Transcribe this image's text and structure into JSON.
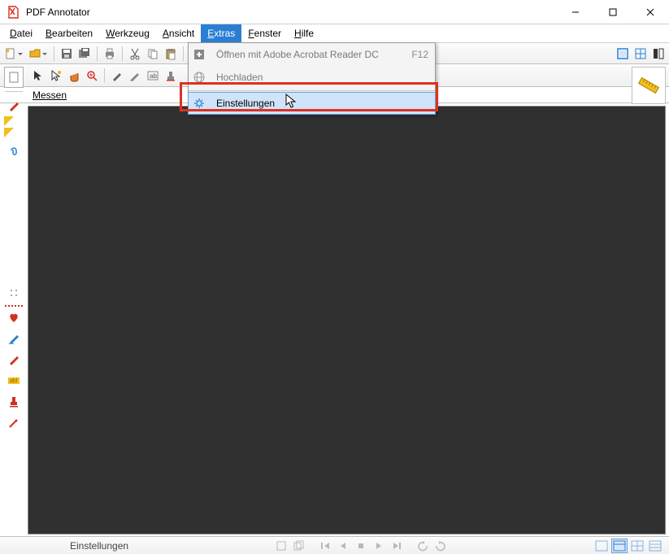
{
  "window": {
    "title": "PDF Annotator"
  },
  "menu": {
    "items": [
      "Datei",
      "Bearbeiten",
      "Werkzeug",
      "Ansicht",
      "Extras",
      "Fenster",
      "Hilfe"
    ],
    "open_index": 4
  },
  "dropdown": {
    "items": [
      {
        "icon": "plus-icon",
        "label": "Öffnen mit Adobe Acrobat Reader DC",
        "shortcut": "F12",
        "disabled": true
      },
      {
        "icon": "globe-icon",
        "label": "Hochladen",
        "shortcut": "",
        "disabled": true
      },
      {
        "sep": true
      },
      {
        "icon": "gear-icon",
        "label": "Einstellungen",
        "shortcut": "",
        "disabled": false,
        "highlight": true
      }
    ]
  },
  "toolbar2_label": "Messen",
  "statusbar": {
    "text": "Einstellungen"
  },
  "icons": {
    "new": "✱",
    "open": "📂",
    "save": "💾",
    "saveall": "⎘",
    "print": "🖨",
    "cut": "✂",
    "copy": "⧉",
    "paste": "📋",
    "undo": "↶",
    "redo": "↷"
  }
}
